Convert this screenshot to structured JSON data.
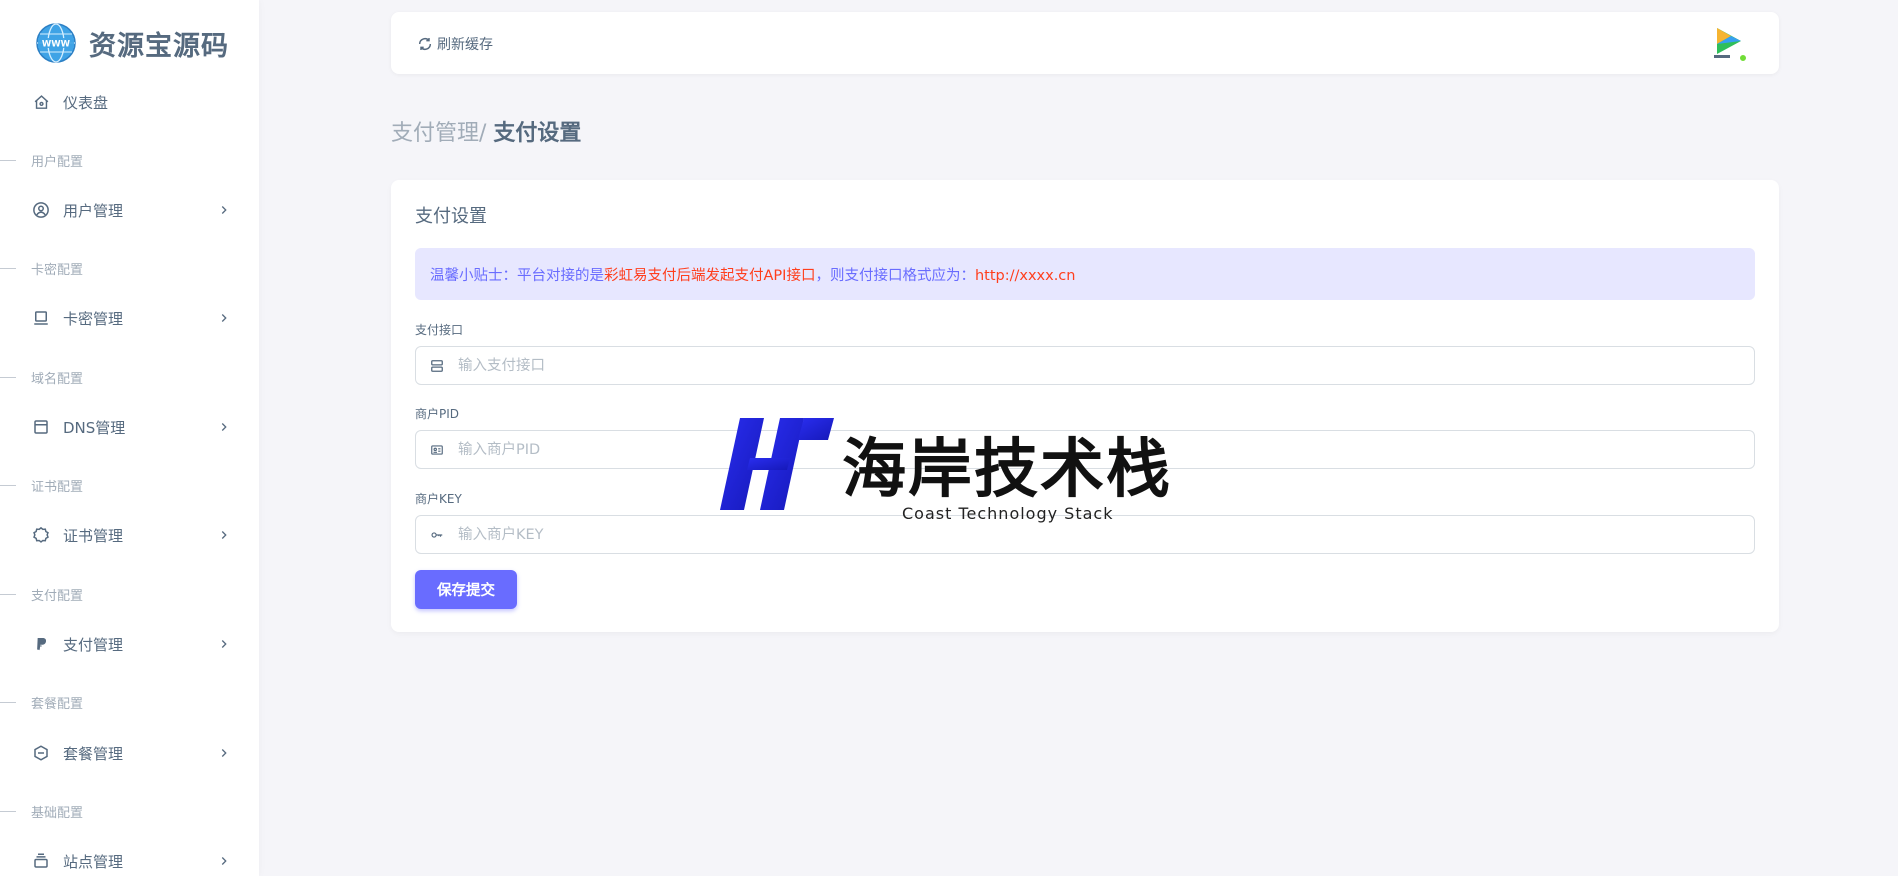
{
  "brand": {
    "name": "资源宝源码",
    "logo_icon": "globe-www-icon"
  },
  "sidebar": {
    "dashboard": {
      "label": "仪表盘",
      "icon": "home-icon"
    },
    "sections": [
      {
        "header": "用户配置",
        "item": "用户管理",
        "icon": "user-circle-icon"
      },
      {
        "header": "卡密配置",
        "item": "卡密管理",
        "icon": "laptop-icon"
      },
      {
        "header": "域名配置",
        "item": "DNS管理",
        "icon": "window-icon"
      },
      {
        "header": "证书配置",
        "item": "证书管理",
        "icon": "badge-icon"
      },
      {
        "header": "支付配置",
        "item": "支付管理",
        "icon": "paypal-icon"
      },
      {
        "header": "套餐配置",
        "item": "套餐管理",
        "icon": "package-icon"
      },
      {
        "header": "基础配置",
        "item": "站点管理",
        "icon": "stack-icon"
      }
    ]
  },
  "navbar": {
    "refresh_label": "刷新缓存",
    "avatar_icon": "video-play-icon"
  },
  "breadcrumb": {
    "parent": "支付管理/",
    "current": "支付设置"
  },
  "card": {
    "title": "支付设置",
    "alert": {
      "prefix": "温馨小贴士：平台对接的是",
      "highlight": "彩虹易支付后端发起支付API接口",
      "middle": "，则支付接口格式应为：",
      "url": "http://xxxx.cn"
    },
    "fields": [
      {
        "label": "支付接口",
        "placeholder": "输入支付接口",
        "value": "",
        "icon": "server-icon"
      },
      {
        "label": "商户PID",
        "placeholder": "输入商户PID",
        "value": "",
        "icon": "id-card-icon"
      },
      {
        "label": "商户KEY",
        "placeholder": "输入商户KEY",
        "value": "",
        "icon": "key-icon"
      }
    ],
    "submit_label": "保存提交"
  },
  "watermark": {
    "title": "海岸技术栈",
    "subtitle": "Coast Technology Stack"
  },
  "colors": {
    "primary": "#696cff",
    "danger": "#ff3e1d",
    "text": "#566a7f",
    "muted": "#a1acb8",
    "bg": "#f5f5f9",
    "online": "#71dd37"
  }
}
